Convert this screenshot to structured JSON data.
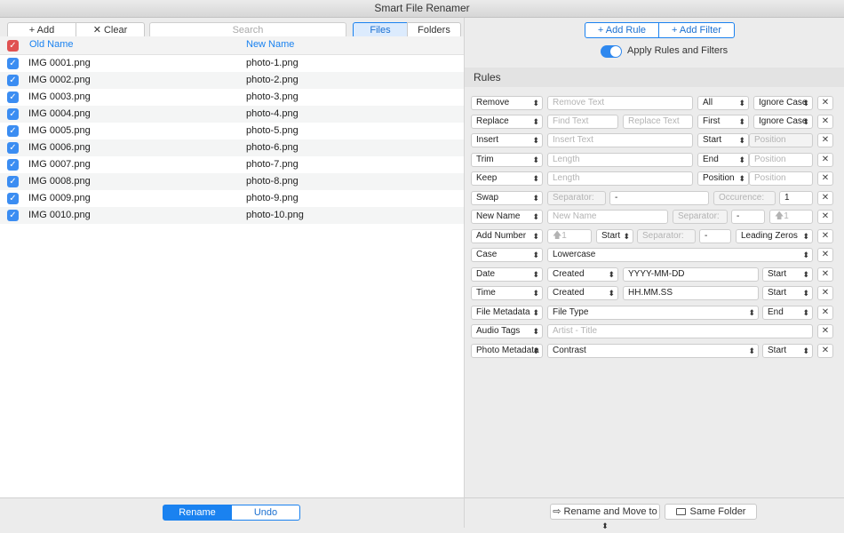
{
  "window": {
    "title": "Smart File Renamer"
  },
  "toolbar": {
    "add_label": "Add",
    "clear_label": "Clear",
    "search_placeholder": "Search",
    "files_label": "Files",
    "folders_label": "Folders"
  },
  "table": {
    "headers": {
      "old": "Old Name",
      "new": "New Name"
    },
    "rows": [
      {
        "old": "IMG 0001.png",
        "new": "photo-1.png"
      },
      {
        "old": "IMG 0002.png",
        "new": "photo-2.png"
      },
      {
        "old": "IMG 0003.png",
        "new": "photo-3.png"
      },
      {
        "old": "IMG 0004.png",
        "new": "photo-4.png"
      },
      {
        "old": "IMG 0005.png",
        "new": "photo-5.png"
      },
      {
        "old": "IMG 0006.png",
        "new": "photo-6.png"
      },
      {
        "old": "IMG 0007.png",
        "new": "photo-7.png"
      },
      {
        "old": "IMG 0008.png",
        "new": "photo-8.png"
      },
      {
        "old": "IMG 0009.png",
        "new": "photo-9.png"
      },
      {
        "old": "IMG 0010.png",
        "new": "photo-10.png"
      }
    ]
  },
  "actions": {
    "rename_label": "Rename",
    "undo_label": "Undo"
  },
  "right": {
    "add_rule_label": "Add Rule",
    "add_filter_label": "Add Filter",
    "apply_label": "Apply Rules and Filters",
    "rules_title": "Rules",
    "move_label": "Rename and Move to",
    "folder_label": "Same Folder"
  },
  "rules": {
    "r0": {
      "type": "Remove",
      "text": "Remove Text",
      "scope": "All",
      "case": "Ignore Case"
    },
    "r1": {
      "type": "Replace",
      "find": "Find Text",
      "replace": "Replace Text",
      "scope": "First",
      "case": "Ignore Case"
    },
    "r2": {
      "type": "Insert",
      "text": "Insert Text",
      "where": "Start",
      "position": "Position"
    },
    "r3": {
      "type": "Trim",
      "length": "Length",
      "where": "End",
      "position": "Position"
    },
    "r4": {
      "type": "Keep",
      "length": "Length",
      "where": "Position",
      "position": "Position"
    },
    "r5": {
      "type": "Swap",
      "sep_label": "Separator:",
      "sep": "-",
      "occ_label": "Occurence:",
      "occ": "1"
    },
    "r6": {
      "type": "New Name",
      "name": "New Name",
      "sep_label": "Separator:",
      "sep": "-",
      "start": "1"
    },
    "r7": {
      "type": "Add Number",
      "start": "1",
      "where": "Start",
      "sep_label": "Separator:",
      "sep": "-",
      "zeros": "Leading Zeros"
    },
    "r8": {
      "type": "Case",
      "value": "Lowercase"
    },
    "r9": {
      "type": "Date",
      "source": "Created",
      "format": "YYYY-MM-DD",
      "where": "Start"
    },
    "r10": {
      "type": "Time",
      "source": "Created",
      "format": "HH.MM.SS",
      "where": "Start"
    },
    "r11": {
      "type": "File Metadata",
      "field": "File Type",
      "where": "End"
    },
    "r12": {
      "type": "Audio Tags",
      "format": "Artist - Title"
    },
    "r13": {
      "type": "Photo Metadata",
      "field": "Contrast",
      "where": "Start"
    }
  },
  "colors": {
    "accent": "#1a82f0",
    "checkbox": "#3b8df2",
    "master_checkbox": "#e05252"
  }
}
